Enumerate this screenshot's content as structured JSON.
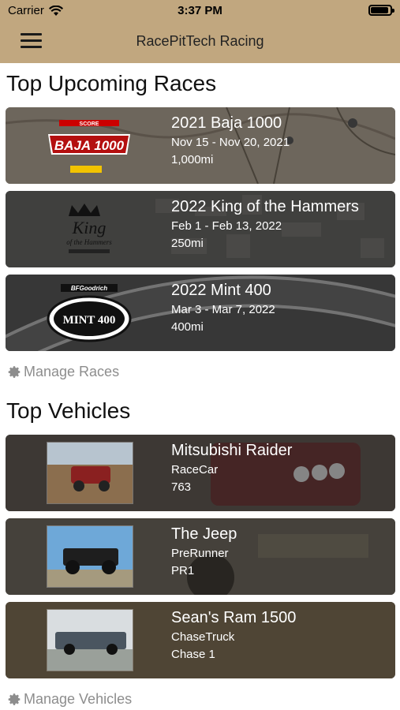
{
  "status_bar": {
    "carrier": "Carrier",
    "time": "3:37 PM"
  },
  "nav": {
    "title": "RacePitTech Racing",
    "menu_icon": "hamburger-menu-icon"
  },
  "races_section": {
    "title": "Top Upcoming Races",
    "items": [
      {
        "name": "2021 Baja 1000",
        "dates": "Nov 15 - Nov 20, 2021",
        "distance": "1,000mi",
        "logo_text": "BAJA 1000",
        "logo_small": "SCORE"
      },
      {
        "name": "2022 King of the Hammers",
        "dates": "Feb 1 - Feb 13, 2022",
        "distance": "250mi",
        "logo_text": "King",
        "logo_small": "of the Hammers"
      },
      {
        "name": "2022 Mint 400",
        "dates": "Mar 3 - Mar 7, 2022",
        "distance": "400mi",
        "logo_text": "MINT 400",
        "logo_small": "BFGoodrich"
      }
    ],
    "manage_label": "Manage Races"
  },
  "vehicles_section": {
    "title": "Top Vehicles",
    "items": [
      {
        "name": "Mitsubishi Raider",
        "type": "RaceCar",
        "number": "763"
      },
      {
        "name": "The Jeep",
        "type": "PreRunner",
        "number": "PR1"
      },
      {
        "name": "Sean's Ram 1500",
        "type": "ChaseTruck",
        "number": "Chase 1"
      }
    ],
    "manage_label": "Manage Vehicles"
  },
  "colors": {
    "nav_background": "#c1a77f",
    "manage_text": "#8d8d8d"
  }
}
